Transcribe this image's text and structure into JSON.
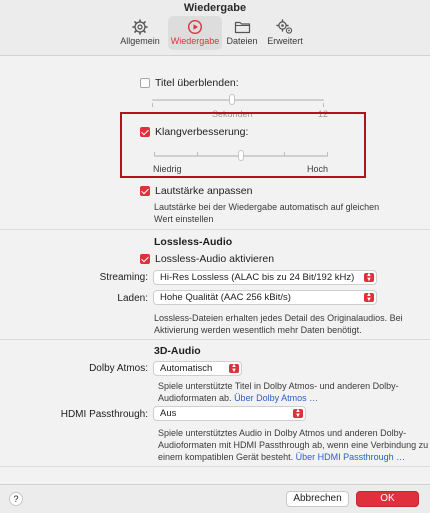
{
  "window": {
    "title": "Wiedergabe"
  },
  "toolbar": {
    "items": [
      {
        "label": "Allgemein",
        "icon": "gear-icon",
        "selected": false
      },
      {
        "label": "Wiedergabe",
        "icon": "play-circle-icon",
        "selected": true
      },
      {
        "label": "Dateien",
        "icon": "folder-icon",
        "selected": false
      },
      {
        "label": "Erweitert",
        "icon": "gears-icon",
        "selected": false
      }
    ]
  },
  "crossfade": {
    "label": "Titel überblenden:",
    "checked": false,
    "slider_unit": "Sekunden",
    "slider_max": "12"
  },
  "sound_enhancer": {
    "label": "Klangverbesserung:",
    "checked": true,
    "min_label": "Niedrig",
    "max_label": "Hoch",
    "level": 0.5
  },
  "sound_check": {
    "label": "Lautstärke anpassen",
    "checked": true,
    "description_line1": "Lautstärke bei der Wiedergabe automatisch auf gleichen",
    "description_line2": "Wert einstellen"
  },
  "lossless": {
    "title": "Lossless-Audio",
    "enable_label": "Lossless-Audio aktivieren",
    "enabled": true,
    "streaming_label": "Streaming:",
    "streaming_value": "Hi-Res Lossless (ALAC bis zu 24 Bit/192 kHz)",
    "download_label": "Laden:",
    "download_value": "Hohe Qualität (AAC 256 kBit/s)",
    "note_line1": "Lossless-Dateien erhalten jedes Detail des Originalaudios. Bei",
    "note_line2": "Aktivierung werden wesentlich mehr Daten benötigt."
  },
  "audio3d": {
    "title": "3D-Audio",
    "dolby_label": "Dolby Atmos:",
    "dolby_value": "Automatisch",
    "dolby_note_line1": "Spiele unterstützte Titel in Dolby Atmos- und anderen Dolby-",
    "dolby_note_line2": "Audioformaten ab.",
    "dolby_link": "Über Dolby Atmos …",
    "hdmi_label": "HDMI Passthrough:",
    "hdmi_value": "Aus",
    "hdmi_note_line1": "Spiele unterstütztes Audio in Dolby Atmos und anderen Dolby-",
    "hdmi_note_line2": "Audioformaten mit HDMI Passthrough ab, wenn eine Verbindung zu",
    "hdmi_note_line3": "einem kompatiblen Gerät besteht.",
    "hdmi_link": "Über HDMI Passthrough …"
  },
  "footer": {
    "help": "?",
    "cancel": "Abbrechen",
    "ok": "OK"
  },
  "colors": {
    "accent": "#e0303b",
    "highlight": "#b1121f",
    "link": "#2a5fc9"
  }
}
